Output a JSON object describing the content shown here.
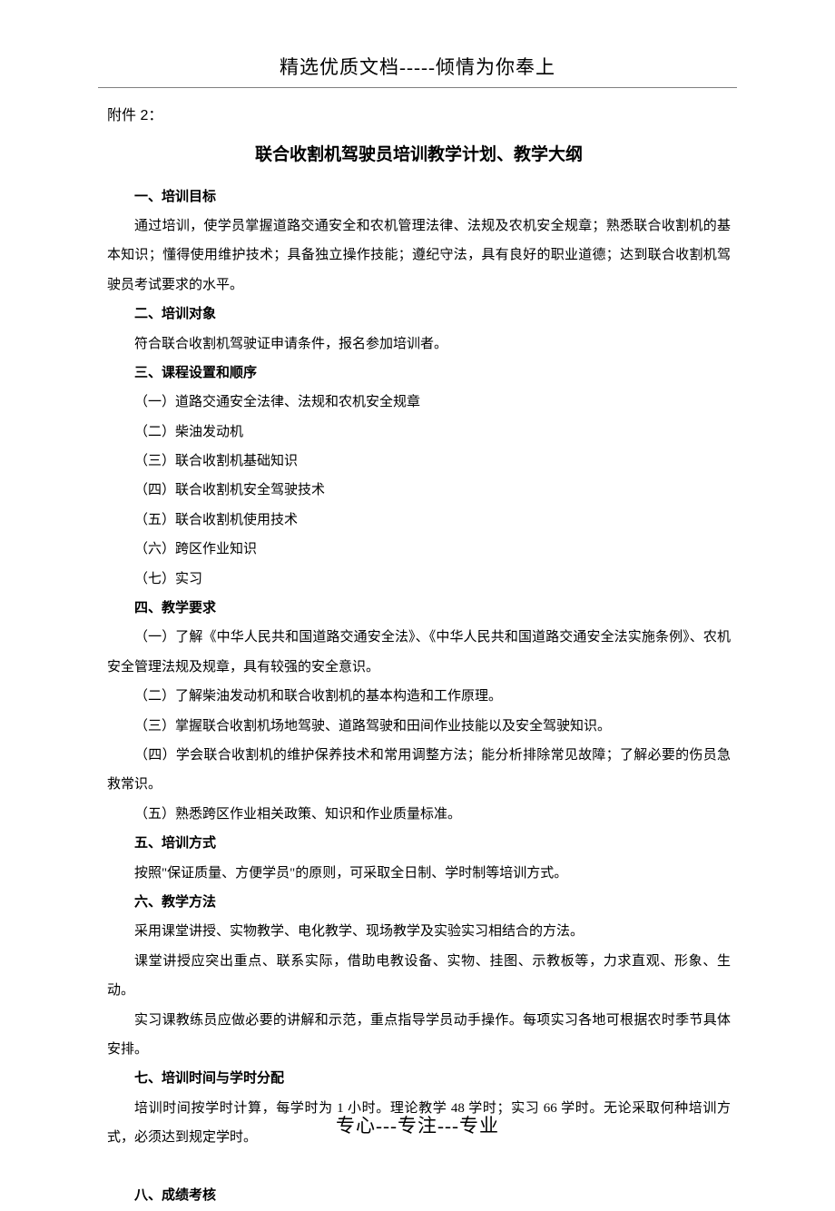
{
  "header": "精选优质文档-----倾情为你奉上",
  "attachment": "附件 2：",
  "title": "联合收割机驾驶员培训教学计划、教学大纲",
  "s1": {
    "h": "一、培训目标",
    "p1": "通过培训，使学员掌握道路交通安全和农机管理法律、法规及农机安全规章；熟悉联合收割机的基本知识；懂得使用维护技术；具备独立操作技能；遵纪守法，具有良好的职业道德；达到联合收割机驾驶员考试要求的水平。"
  },
  "s2": {
    "h": "二、培训对象",
    "p1": "符合联合收割机驾驶证申请条件，报名参加培训者。"
  },
  "s3": {
    "h": "三、课程设置和顺序",
    "i1": "（一）道路交通安全法律、法规和农机安全规章",
    "i2": "（二）柴油发动机",
    "i3": "（三）联合收割机基础知识",
    "i4": "（四）联合收割机安全驾驶技术",
    "i5": "（五）联合收割机使用技术",
    "i6": "（六）跨区作业知识",
    "i7": "（七）实习"
  },
  "s4": {
    "h": "四、教学要求",
    "p1": "（一）了解《中华人民共和国道路交通安全法》、《中华人民共和国道路交通安全法实施条例》、农机安全管理法规及规章，具有较强的安全意识。",
    "p2": "（二）了解柴油发动机和联合收割机的基本构造和工作原理。",
    "p3": "（三）掌握联合收割机场地驾驶、道路驾驶和田间作业技能以及安全驾驶知识。",
    "p4": "（四）学会联合收割机的维护保养技术和常用调整方法；能分析排除常见故障；了解必要的伤员急救常识。",
    "p5": "（五）熟悉跨区作业相关政策、知识和作业质量标准。"
  },
  "s5": {
    "h": "五、培训方式",
    "p1": "按照\"保证质量、方便学员\"的原则，可采取全日制、学时制等培训方式。"
  },
  "s6": {
    "h": "六、教学方法",
    "p1": "采用课堂讲授、实物教学、电化教学、现场教学及实验实习相结合的方法。",
    "p2": "课堂讲授应突出重点、联系实际，借助电教设备、实物、挂图、示教板等，力求直观、形象、生动。",
    "p3": "实习课教练员应做必要的讲解和示范，重点指导学员动手操作。每项实习各地可根据农时季节具体安排。"
  },
  "s7": {
    "h": "七、培训时间与学时分配",
    "p1": "培训时间按学时计算，每学时为 1 小时。理论教学 48 学时；实习 66 学时。无论采取何种培训方式，必须达到规定学时。"
  },
  "s8": {
    "h": "八、成绩考核"
  },
  "footer": "专心---专注---专业"
}
